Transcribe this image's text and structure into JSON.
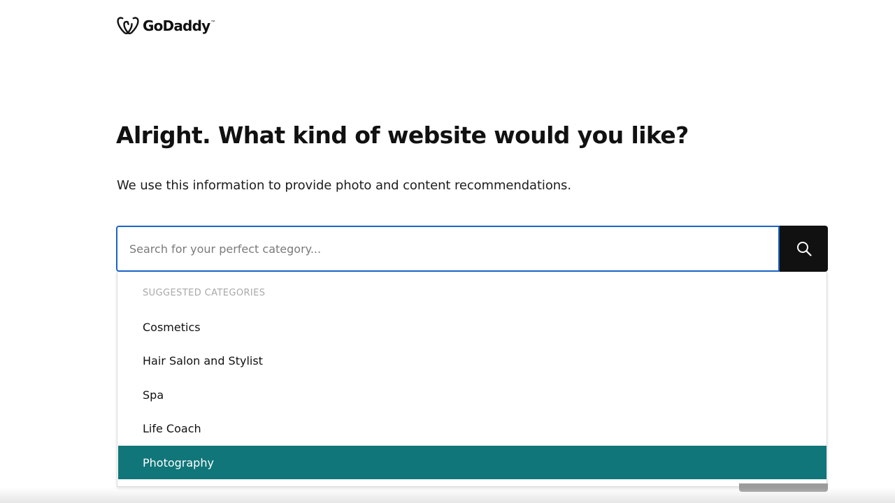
{
  "brand": {
    "name": "GoDaddy",
    "trademark": "™",
    "icon": "godaddy-logo-icon"
  },
  "page": {
    "heading": "Alright. What kind of website would you like?",
    "subtitle": "We use this information to provide photo and content recommendations."
  },
  "search": {
    "placeholder": "Search for your perfect category...",
    "value": "",
    "button_icon": "search-icon"
  },
  "dropdown": {
    "header": "SUGGESTED CATEGORIES",
    "items": [
      {
        "label": "Cosmetics",
        "selected": false
      },
      {
        "label": "Hair Salon and Stylist",
        "selected": false
      },
      {
        "label": "Spa",
        "selected": false
      },
      {
        "label": "Life Coach",
        "selected": false
      },
      {
        "label": "Photography",
        "selected": true
      }
    ]
  },
  "colors": {
    "accent_blue": "#1b63c8",
    "highlight_teal": "#107679",
    "button_black": "#111111",
    "muted_text": "#a9a9a9"
  }
}
